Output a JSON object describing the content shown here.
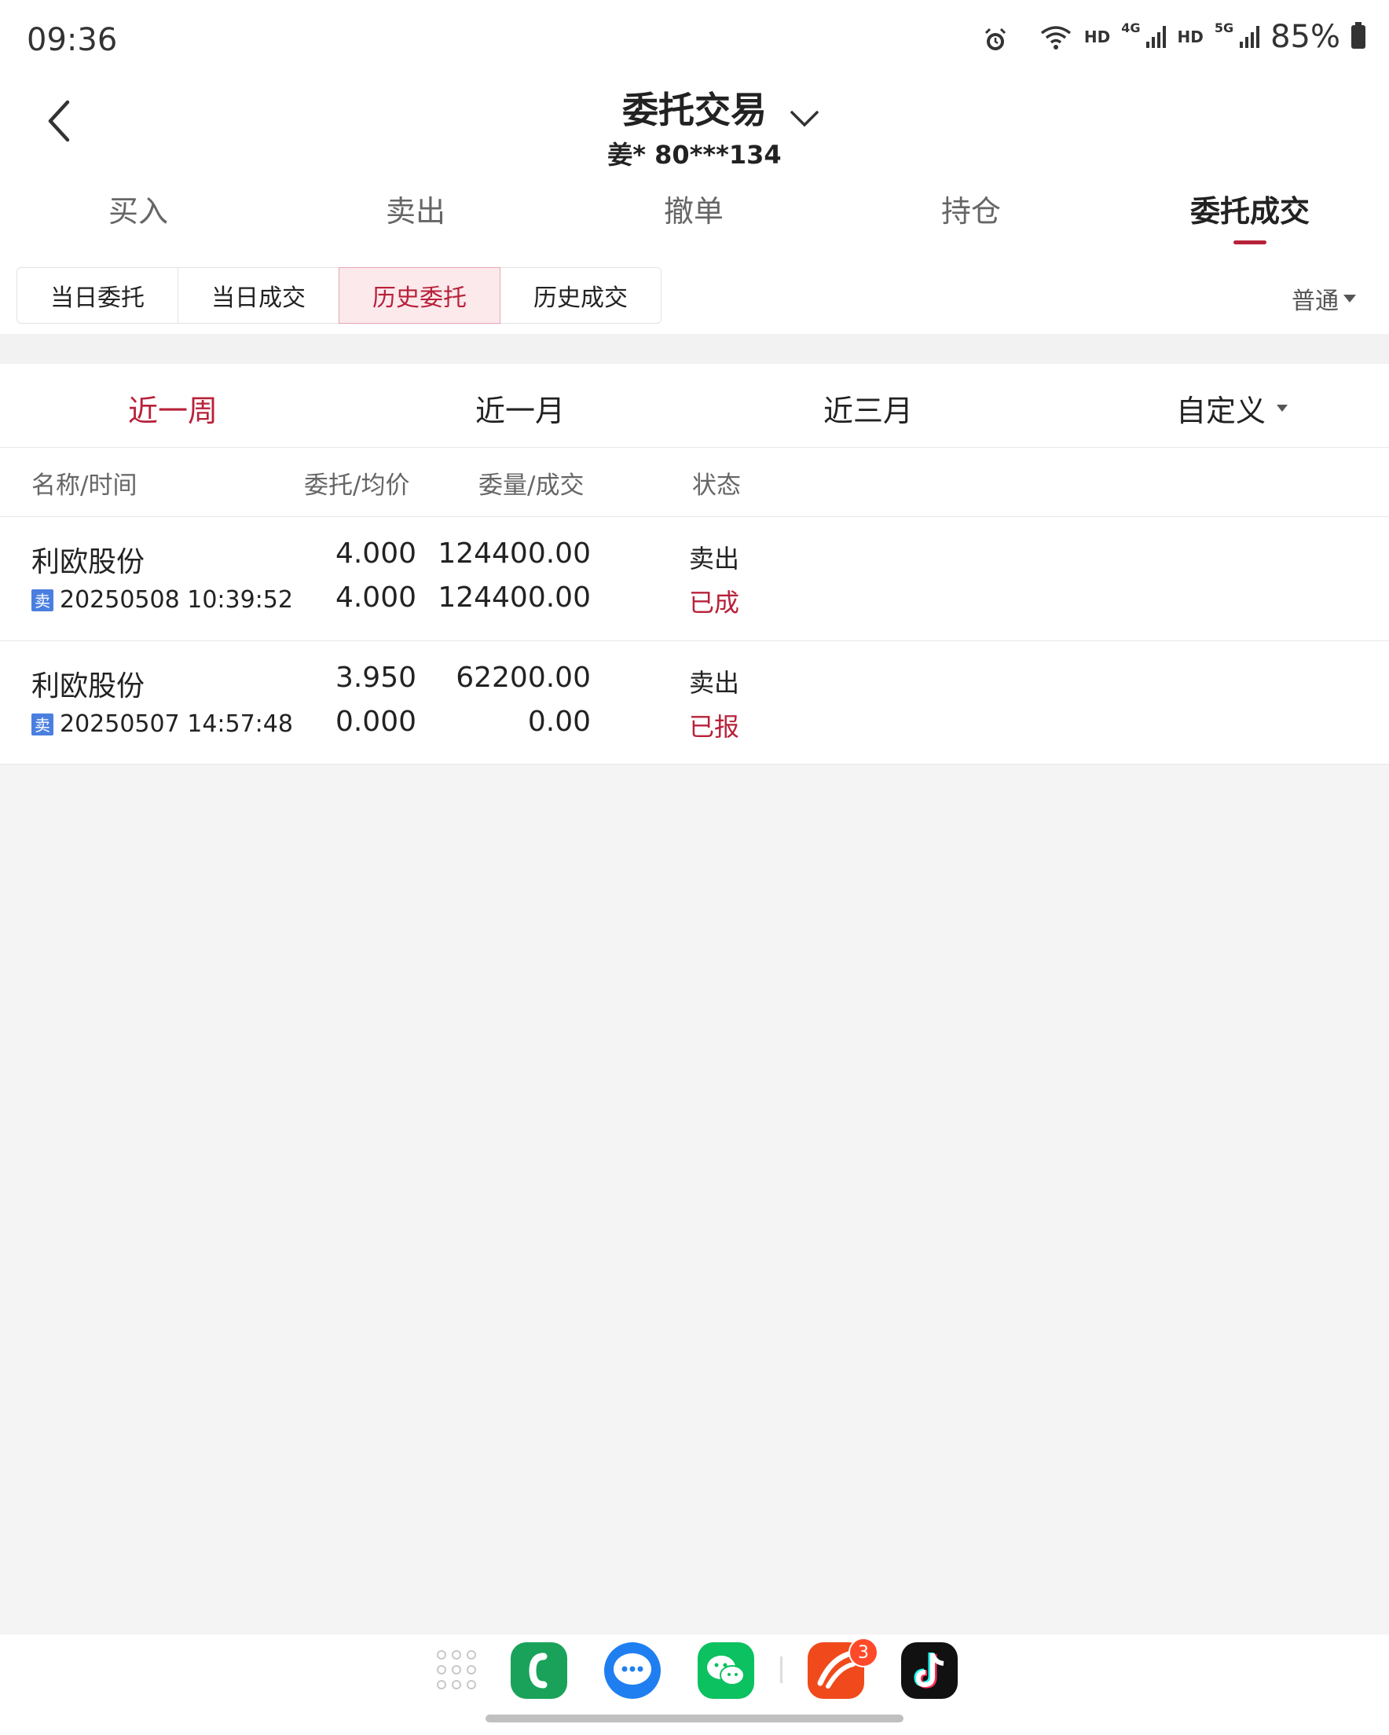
{
  "status_bar": {
    "time": "09:36",
    "hd1": "HD",
    "net1": "4G",
    "hd2": "HD",
    "net2": "5G",
    "battery": "85%"
  },
  "header": {
    "title": "委托交易",
    "account": "姜* 80***134"
  },
  "main_tabs": [
    "买入",
    "卖出",
    "撤单",
    "持仓",
    "委托成交"
  ],
  "active_main_tab": "委托成交",
  "sub_tabs": [
    "当日委托",
    "当日成交",
    "历史委托",
    "历史成交"
  ],
  "active_sub_tab": "历史委托",
  "mode_select": "普通",
  "periods": [
    "近一周",
    "近一月",
    "近三月",
    "自定义"
  ],
  "active_period": "近一周",
  "table": {
    "columns": [
      "名称/时间",
      "委托/均价",
      "委量/成交",
      "状态"
    ],
    "rows": [
      {
        "name": "利欧股份",
        "badge": "卖",
        "time": "20250508 10:39:52",
        "price": "4.000",
        "avg_price": "4.000",
        "qty": "124400.00",
        "filled": "124400.00",
        "direction": "卖出",
        "status": "已成"
      },
      {
        "name": "利欧股份",
        "badge": "卖",
        "time": "20250507 14:57:48",
        "price": "3.950",
        "avg_price": "0.000",
        "qty": "62200.00",
        "filled": "0.00",
        "direction": "卖出",
        "status": "已报"
      }
    ]
  },
  "dock": {
    "apps": [
      "app-drawer-icon",
      "phone-app-icon",
      "messages-app-icon",
      "wechat-app-icon",
      "trading-app-icon",
      "tiktok-app-icon"
    ],
    "trading_app_badge": "3"
  }
}
